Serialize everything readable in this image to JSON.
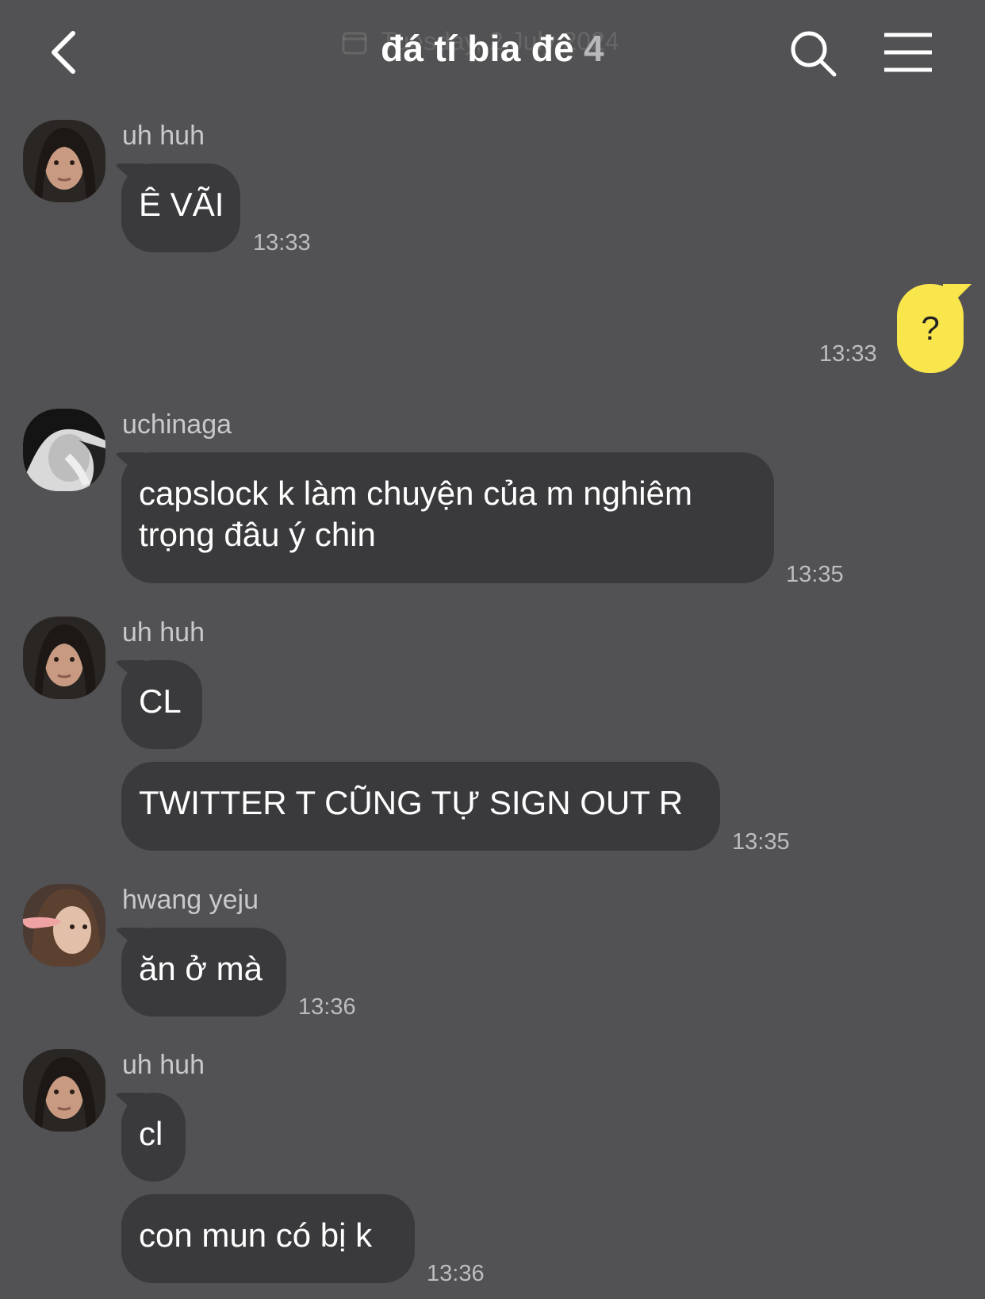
{
  "header": {
    "title": "đá tí bia đê",
    "member_count": "4",
    "date_ghost": "Tuesday, 2 July 2024"
  },
  "messages": [
    {
      "sender": "uh huh",
      "bubbles": [
        "Ê VÃI"
      ],
      "time": "13:33"
    },
    {
      "mine": true,
      "text": "?",
      "time": "13:33"
    },
    {
      "sender": "uchinaga",
      "bubbles": [
        "capslock k làm chuyện của m nghiêm trọng đâu ý chin"
      ],
      "time": "13:35"
    },
    {
      "sender": "uh huh",
      "bubbles": [
        "CL",
        "TWITTER T CŨNG TỰ SIGN OUT R"
      ],
      "time": "13:35"
    },
    {
      "sender": "hwang yeju",
      "bubbles": [
        "ăn ở mà"
      ],
      "time": "13:36"
    },
    {
      "sender": "uh huh",
      "bubbles": [
        "cl",
        "con mun có bị k"
      ],
      "time": "13:36"
    }
  ],
  "icons": {
    "back": "chevron-left-icon",
    "search": "search-icon",
    "menu": "hamburger-menu-icon"
  },
  "colors": {
    "background": "#525153",
    "bubble_other": "#3a393c",
    "bubble_mine": "#f9e54c"
  }
}
